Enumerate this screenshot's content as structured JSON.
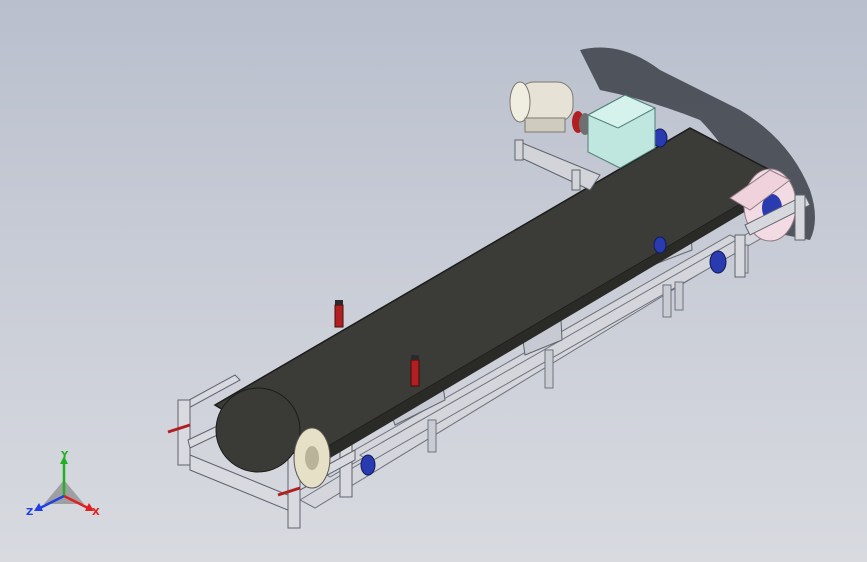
{
  "triad": {
    "x_label": "X",
    "y_label": "Y",
    "z_label": "Z"
  },
  "colors": {
    "belt": "#3b3b37",
    "frame": "#d4d6dc",
    "frame_dark": "#8e929c",
    "motor": "#e6e3d6",
    "gearbox": "#bfe6df",
    "bearing": "#2a3bb0",
    "pulley": "#f3dbe3",
    "coupling": "#b02020",
    "axis_x": "#e02020",
    "axis_y": "#20b020",
    "axis_z": "#2040e0"
  },
  "icons": {
    "triad": "coordinate-triad-icon"
  }
}
